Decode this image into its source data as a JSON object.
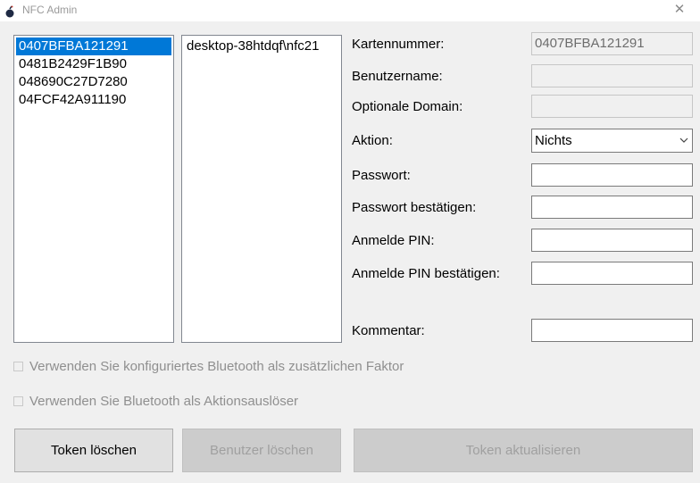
{
  "window": {
    "title": "NFC Admin",
    "close_glyph": "✕"
  },
  "token_list": {
    "items": [
      {
        "label": "0407BFBA121291",
        "selected": true
      },
      {
        "label": "0481B2429F1B90",
        "selected": false
      },
      {
        "label": "048690C27D7280",
        "selected": false
      },
      {
        "label": "04FCF42A911190",
        "selected": false
      }
    ]
  },
  "user_list": {
    "items": [
      {
        "label": "desktop-38htdqf\\nfc21"
      }
    ]
  },
  "form": {
    "card_number_label": "Kartennummer:",
    "card_number_value": "0407BFBA121291",
    "username_label": "Benutzername:",
    "username_value": "",
    "domain_label": "Optionale Domain:",
    "domain_value": "",
    "action_label": "Aktion:",
    "action_value": "Nichts",
    "password_label": "Passwort:",
    "password_confirm_label": "Passwort bestätigen:",
    "pin_label": "Anmelde PIN:",
    "pin_confirm_label": "Anmelde PIN bestätigen:",
    "comment_label": "Kommentar:"
  },
  "options": {
    "bluetooth_factor_label": "Verwenden Sie konfiguriertes Bluetooth als zusätzlichen Faktor",
    "bluetooth_trigger_label": "Verwenden Sie Bluetooth als Aktionsauslöser"
  },
  "buttons": {
    "delete_token": "Token löschen",
    "delete_user": "Benutzer löschen",
    "update_token": "Token aktualisieren"
  },
  "colors": {
    "selection": "#0078d7",
    "window_bg": "#f0f0f0",
    "disabled_text": "#a0a0a0"
  }
}
